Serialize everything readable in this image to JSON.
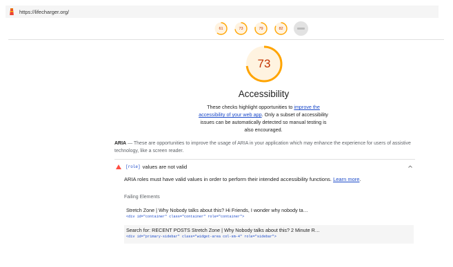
{
  "url_bar": {
    "url": "https://lifecharger.org/",
    "icon": "lighthouse-icon"
  },
  "gauges": [
    {
      "score": "61",
      "color": "#ffa400"
    },
    {
      "score": "73",
      "color": "#ffa400",
      "active": true
    },
    {
      "score": "79",
      "color": "#ffa400"
    },
    {
      "score": "82",
      "color": "#ffa400"
    },
    {
      "score": "",
      "icon": "pwa-icon"
    }
  ],
  "category": {
    "score": "73",
    "score_fraction": 0.73,
    "title": "Accessibility",
    "desc_pre": "These checks highlight opportunities to ",
    "desc_link": "improve the accessibility of your web app",
    "desc_post": ". Only a subset of accessibility issues can be automatically detected so manual testing is also encouraged."
  },
  "aria_group": {
    "title": "ARIA",
    "description": " — These are opportunities to improve the usage of ARIA in your application which may enhance the experience for users of assistive technology, like a screen reader."
  },
  "audit": {
    "code": "[role]",
    "title": "values are not valid",
    "description": "ARIA roles must have valid values in order to perform their intended accessibility functions. ",
    "learn_more": "Learn more",
    "description_end": ".",
    "failing_label": "Failing Elements",
    "nodes": [
      {
        "snippet": "Stretch Zone | Why Nobody talks about this? Hi Friends, I wonder why nobody ta…",
        "html": "<div id=\"container\" class=\"container\" role=\"container\">"
      },
      {
        "snippet": "Search for: RECENT POSTS Stretch Zone | Why Nobody talks about this? 2 Minute R…",
        "html": "<div id=\"primary-sidebar\" class=\"widget-area col-sm-4\" role=\"sidebar\">"
      }
    ]
  },
  "colors": {
    "warn": "#c33300",
    "average": "#ffa400",
    "link": "#1a49c9",
    "fail": "#ff4e42"
  }
}
